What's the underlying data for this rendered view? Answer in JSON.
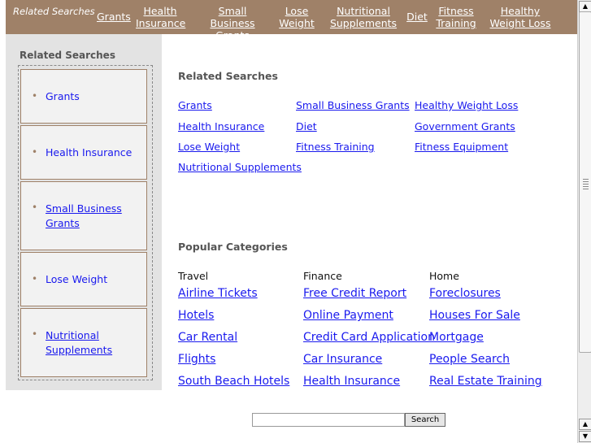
{
  "topbar": {
    "related_label": "Related Searches",
    "links": [
      {
        "label": "Grants"
      },
      {
        "label": "Health Insurance"
      },
      {
        "label": "Small Business Grants"
      },
      {
        "label": "Lose Weight"
      },
      {
        "label": "Nutritional Supplements"
      },
      {
        "label": "Diet"
      },
      {
        "label": "Fitness Training"
      },
      {
        "label": "Healthy Weight Loss"
      }
    ]
  },
  "sidebar": {
    "title": "Related Searches",
    "items": [
      {
        "label": "Grants"
      },
      {
        "label": "Health Insurance"
      },
      {
        "label": "Small Business Grants"
      },
      {
        "label": "Lose Weight"
      },
      {
        "label": "Nutritional Supplements"
      }
    ]
  },
  "main": {
    "related_title": "Related Searches",
    "related_links": [
      "Grants",
      "Small Business Grants",
      "Healthy Weight Loss",
      "Health Insurance",
      "Diet",
      "Government Grants",
      "Lose Weight",
      "Fitness Training",
      "Fitness Equipment",
      "Nutritional Supplements"
    ],
    "popular_title": "Popular Categories",
    "categories": [
      {
        "heading": "Travel",
        "links": [
          "Airline Tickets",
          "Hotels",
          "Car Rental",
          "Flights",
          "South Beach Hotels"
        ]
      },
      {
        "heading": "Finance",
        "links": [
          "Free Credit Report",
          "Online Payment",
          "Credit Card Application",
          "Car Insurance",
          "Health Insurance"
        ]
      },
      {
        "heading": "Home",
        "links": [
          "Foreclosures",
          "Houses For Sale",
          "Mortgage",
          "People Search",
          "Real Estate Training"
        ]
      }
    ]
  },
  "search": {
    "value": "",
    "button_label": "Search"
  },
  "colors": {
    "topbar_bg": "#9f8168",
    "link": "#1a1aee",
    "sidebar_bg": "#e3e3e3"
  }
}
